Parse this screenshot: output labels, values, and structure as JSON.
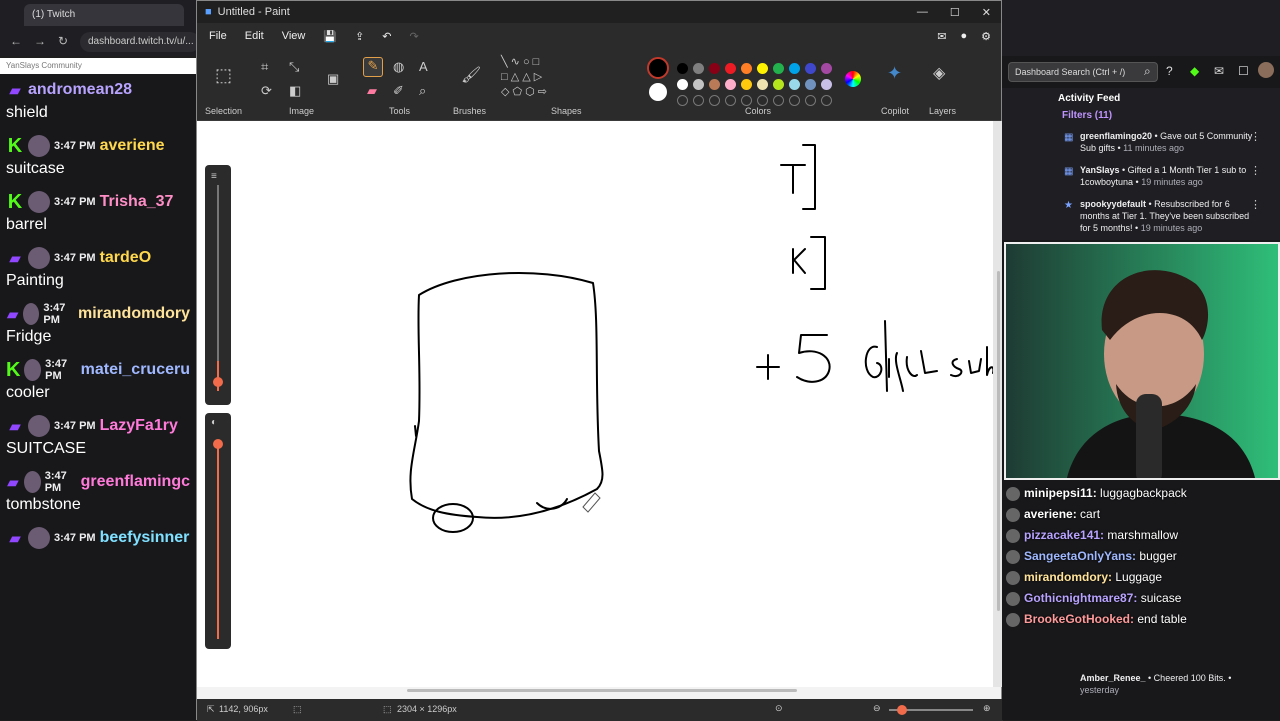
{
  "browser": {
    "tab_title": "(1) Twitch",
    "url": "dashboard.twitch.tv/u/..."
  },
  "left_chat": {
    "header": "YanSlays Community",
    "messages": [
      {
        "badge": "tw",
        "user": "andromean28",
        "user_color": "#b8a3ff",
        "text": "shield",
        "time": ""
      },
      {
        "badge": "k",
        "time": "3:47 PM",
        "user": "averiene",
        "user_color": "#ffd84d",
        "text": "suitcase"
      },
      {
        "badge": "k",
        "time": "3:47 PM",
        "user": "Trisha_37",
        "user_color": "#ff8ec6",
        "text": "barrel"
      },
      {
        "badge": "tw",
        "time": "3:47 PM",
        "user": "tardeO",
        "user_color": "#ffd84d",
        "text": "Painting"
      },
      {
        "badge": "tw",
        "time": "3:47 PM",
        "user": "mirandomdory",
        "user_color": "#ffe39a",
        "text": "Fridge"
      },
      {
        "badge": "k",
        "time": "3:47 PM",
        "user": "matei_cruceru",
        "user_color": "#9fb8ff",
        "text": "cooler"
      },
      {
        "badge": "tw",
        "time": "3:47 PM",
        "user": "LazyFa1ry",
        "user_color": "#ff7ad9",
        "text": "SUITCASE"
      },
      {
        "badge": "tw",
        "time": "3:47 PM",
        "user": "greenflamingc",
        "user_color": "#ff7ad9",
        "text": "tombstone"
      },
      {
        "badge": "tw",
        "time": "3:47 PM",
        "user": "beefysinner",
        "user_color": "#7fe0ff",
        "text": ""
      }
    ]
  },
  "paint": {
    "title": "Untitled - Paint",
    "menu": [
      "File",
      "Edit",
      "View"
    ],
    "groups": [
      "Selection",
      "Image",
      "Tools",
      "Brushes",
      "Shapes",
      "Colors",
      "Copilot",
      "Layers"
    ],
    "status_cursor": "1142, 906px",
    "status_size": "2304 × 1296px",
    "colors": {
      "row1": [
        "#000000",
        "#7f7f7f",
        "#880015",
        "#ed1c24",
        "#ff7f27",
        "#fff200",
        "#22b14c",
        "#00a2e8",
        "#3f48cc",
        "#a349a4"
      ],
      "row2": [
        "#ffffff",
        "#c3c3c3",
        "#b97a57",
        "#ffaec9",
        "#ffc90e",
        "#efe4b0",
        "#b5e61d",
        "#99d9ea",
        "#7092be",
        "#c8bfe7"
      ]
    }
  },
  "dashboard": {
    "search_placeholder": "Dashboard Search (Ctrl + /)",
    "activity_title": "Activity Feed",
    "filters": "Filters (11)",
    "feed": [
      {
        "user": "greenflamingo20",
        "text": " • Gave out 5 Community Sub gifts • ",
        "time": "11 minutes ago"
      },
      {
        "user": "YanSlays",
        "text": " • Gifted a 1 Month Tier 1 sub to 1cowboytuna • ",
        "time": "19 minutes ago"
      },
      {
        "user": "spookyydefault",
        "text": " • Resubscribed for 6 months at Tier 1. They've been subscribed for 5 months! • ",
        "time": "19 minutes ago"
      }
    ],
    "bottom_feed": [
      {
        "user": "Amber_Renee_",
        "text": " • Cheered 100 Bits. • ",
        "time": "yesterday"
      }
    ]
  },
  "overlay_chat": [
    {
      "user": "minipepsi11:",
      "color": "#ffffff",
      "msg": "luggagbackpack"
    },
    {
      "user": "averiene:",
      "color": "#ffffff",
      "msg": "cart"
    },
    {
      "user": "pizzacake141:",
      "color": "#b8a3ff",
      "msg": "marshmallow"
    },
    {
      "user": "SangeetaOnlyYans:",
      "color": "#9fb8ff",
      "msg": "bugger"
    },
    {
      "user": "mirandomdory:",
      "color": "#ffe39a",
      "msg": "Luggage"
    },
    {
      "user": "Gothicnightmare87:",
      "color": "#b8a3ff",
      "msg": "suicase"
    },
    {
      "user": "BrookeGotHooked:",
      "color": "#ff9b9b",
      "msg": "end table"
    }
  ]
}
